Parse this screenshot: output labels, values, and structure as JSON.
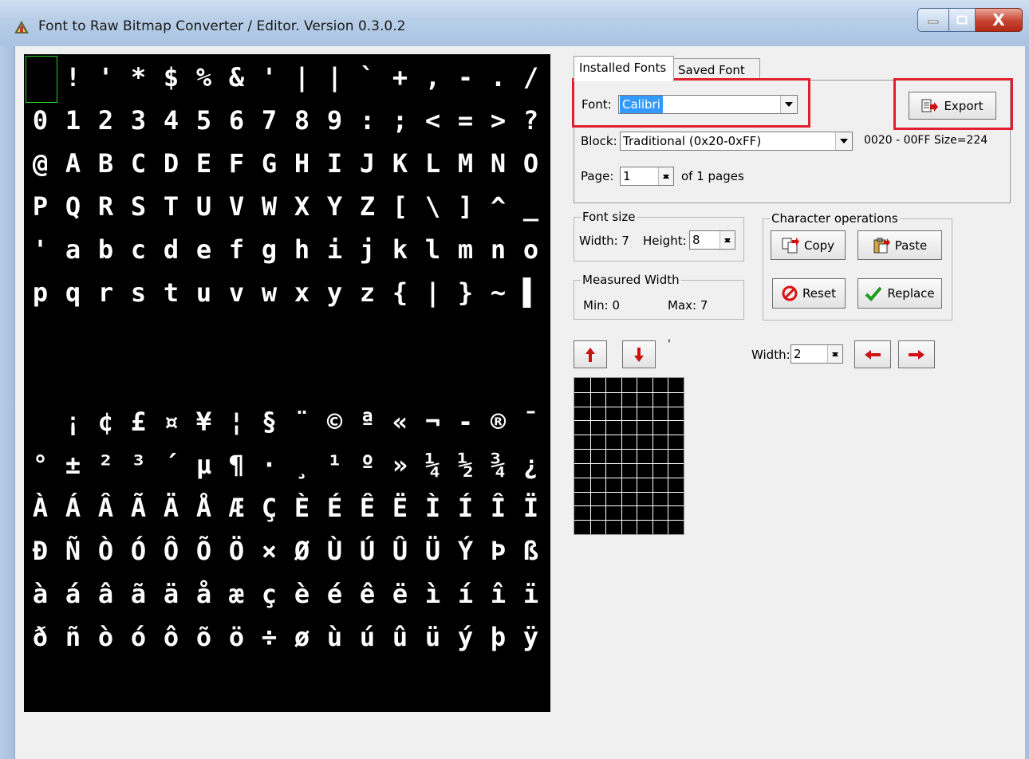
{
  "window": {
    "title": "Font to Raw Bitmap Converter / Editor. Version 0.3.0.2",
    "caption": {
      "minimize": "–",
      "maximize": "□",
      "close": "X"
    }
  },
  "glyph_rows": [
    [
      "",
      "!",
      "'",
      "*",
      "$",
      "%",
      "&",
      "'",
      "|",
      "|",
      "`",
      "+",
      ",",
      "-",
      ".",
      "/"
    ],
    [
      "0",
      "1",
      "2",
      "3",
      "4",
      "5",
      "6",
      "7",
      "8",
      "9",
      ":",
      ";",
      "<",
      "=",
      ">",
      "?"
    ],
    [
      "@",
      "A",
      "B",
      "C",
      "D",
      "E",
      "F",
      "G",
      "H",
      "I",
      "J",
      "K",
      "L",
      "M",
      "N",
      "O"
    ],
    [
      "P",
      "Q",
      "R",
      "S",
      "T",
      "U",
      "V",
      "W",
      "X",
      "Y",
      "Z",
      "[",
      "\\",
      "]",
      "^",
      "_"
    ],
    [
      "'",
      "a",
      "b",
      "c",
      "d",
      "e",
      "f",
      "g",
      "h",
      "i",
      "j",
      "k",
      "l",
      "m",
      "n",
      "o"
    ],
    [
      "p",
      "q",
      "r",
      "s",
      "t",
      "u",
      "v",
      "w",
      "x",
      "y",
      "z",
      "{",
      "|",
      "}",
      "~",
      "▌"
    ],
    [
      "",
      "",
      "",
      "",
      "",
      "",
      "",
      "",
      "",
      "",
      "",
      "",
      "",
      "",
      "",
      ""
    ],
    [
      "",
      "",
      "",
      "",
      "",
      "",
      "",
      "",
      "",
      "",
      "",
      "",
      "",
      "",
      "",
      ""
    ],
    [
      "",
      "¡",
      "¢",
      "£",
      "¤",
      "¥",
      "¦",
      "§",
      "¨",
      "©",
      "ª",
      "«",
      "¬",
      "-",
      "®",
      "¯"
    ],
    [
      "°",
      "±",
      "²",
      "³",
      "´",
      "µ",
      "¶",
      "·",
      "¸",
      "¹",
      "º",
      "»",
      "¼",
      "½",
      "¾",
      "¿"
    ],
    [
      "À",
      "Á",
      "Â",
      "Ã",
      "Ä",
      "Å",
      "Æ",
      "Ç",
      "È",
      "É",
      "Ê",
      "Ë",
      "Ì",
      "Í",
      "Î",
      "Ï"
    ],
    [
      "Ð",
      "Ñ",
      "Ò",
      "Ó",
      "Ô",
      "Õ",
      "Ö",
      "×",
      "Ø",
      "Ù",
      "Ú",
      "Û",
      "Ü",
      "Ý",
      "Þ",
      "ß"
    ],
    [
      "à",
      "á",
      "â",
      "ã",
      "ä",
      "å",
      "æ",
      "ç",
      "è",
      "é",
      "ê",
      "ë",
      "ì",
      "í",
      "î",
      "ï"
    ],
    [
      "ð",
      "ñ",
      "ò",
      "ó",
      "ô",
      "õ",
      "ö",
      "÷",
      "ø",
      "ù",
      "ú",
      "û",
      "ü",
      "ý",
      "þ",
      "ÿ"
    ]
  ],
  "tabs": [
    "Installed Fonts",
    "Saved Font"
  ],
  "font_panel": {
    "font_label": "Font:",
    "font_value": "Calibri",
    "export_label": "Export",
    "block_label": "Block:",
    "block_value": "Traditional (0x20-0xFF)",
    "block_info": "0020 - 00FF Size=224",
    "page_label": "Page:",
    "page_value": "1",
    "page_of": "of 1 pages"
  },
  "font_size": {
    "title": "Font size",
    "width_label": "Width: 7",
    "height_label": "Height:",
    "height_value": "8"
  },
  "measured_width": {
    "title": "Measured Width",
    "min": "Min: 0",
    "max": "Max: 7"
  },
  "char_ops": {
    "title": "Character operations",
    "copy": "Copy",
    "paste": "Paste",
    "reset": "Reset",
    "replace": "Replace"
  },
  "editor": {
    "preview_char": "'",
    "width_label": "Width:",
    "width_value": "2"
  },
  "colors": {
    "highlight": "#e0202e",
    "arrow": "#cc1111",
    "selection": "#3399ff",
    "cursor": "#1fd11f"
  }
}
